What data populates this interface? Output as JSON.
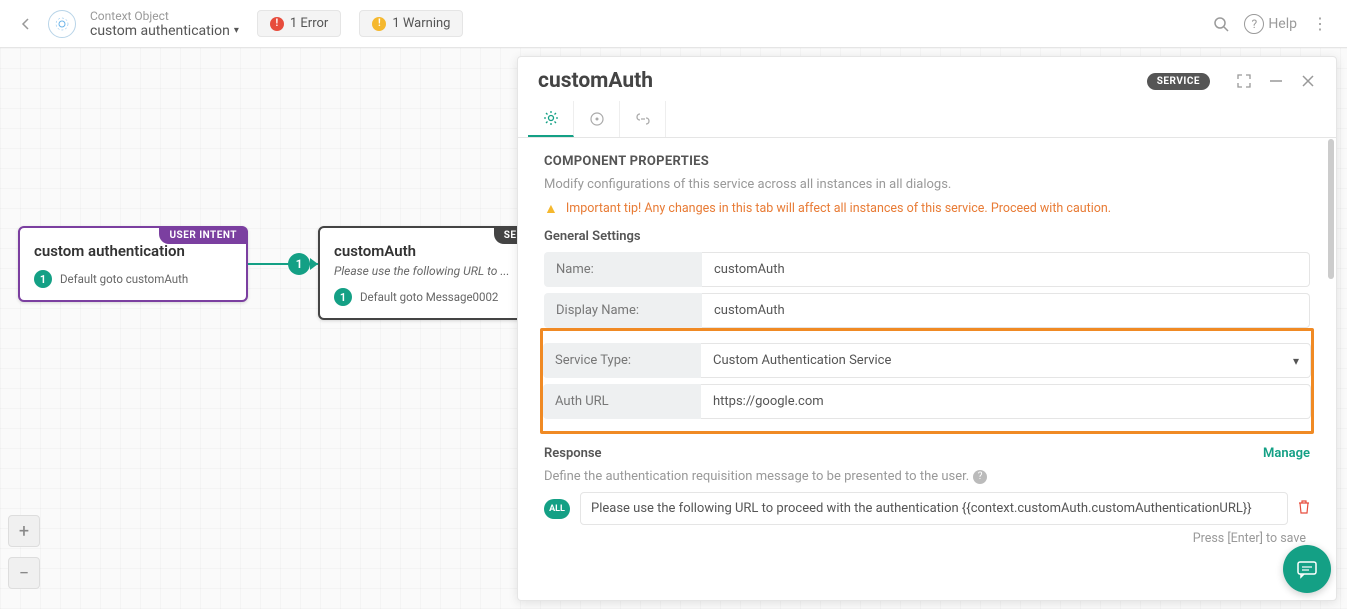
{
  "header": {
    "breadcrumb_label": "Context Object",
    "breadcrumb_value": "custom authentication",
    "error_label": "1 Error",
    "warning_label": "1 Warning",
    "help_label": "Help"
  },
  "node_ui": {
    "tag": "USER INTENT",
    "title": "custom authentication",
    "goto": "Default goto customAuth",
    "step": "1"
  },
  "node_svc": {
    "tag": "SERVICE",
    "title": "customAuth",
    "sub": "Please use the following URL to ...",
    "goto": "Default goto Message0002",
    "step": "1"
  },
  "connector_badge": "1",
  "panel": {
    "title": "customAuth",
    "badge": "SERVICE",
    "section_title": "COMPONENT PROPERTIES",
    "section_desc": "Modify configurations of this service across all instances in all dialogs.",
    "alert": "Important tip! Any changes in this tab will affect all instances of this service. Proceed with caution.",
    "general_title": "General Settings",
    "fields": {
      "name_label": "Name:",
      "name_value": "customAuth",
      "display_label": "Display Name:",
      "display_value": "customAuth",
      "type_label": "Service Type:",
      "type_value": "Custom Authentication Service",
      "auth_label": "Auth URL",
      "auth_value": "https://google.com"
    },
    "response": {
      "title": "Response",
      "manage": "Manage",
      "desc": "Define the authentication requisition message to be presented to the user.",
      "all_badge": "ALL",
      "value": "Please use the following URL to proceed with the authentication {{context.customAuth.customAuthenticationURL}}",
      "hint": "Press [Enter] to save"
    }
  },
  "zoom": {
    "plus": "+",
    "minus": "−"
  }
}
